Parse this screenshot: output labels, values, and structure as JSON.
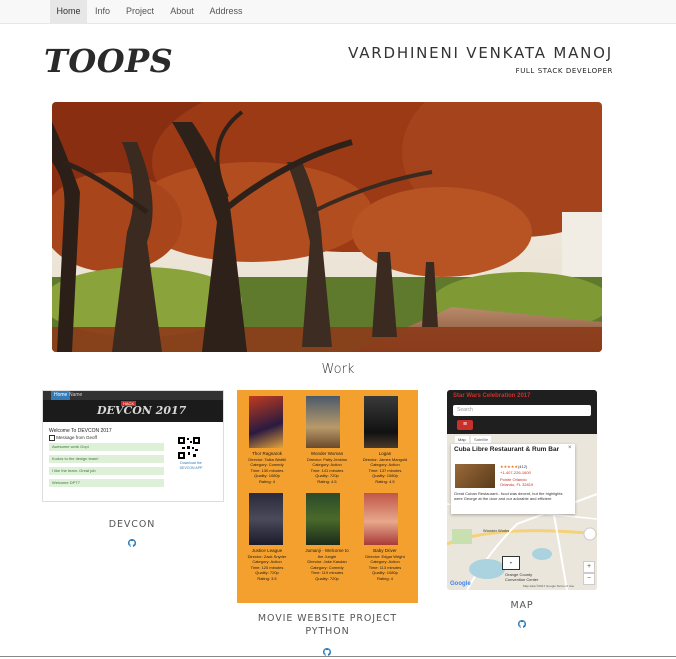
{
  "nav": {
    "items": [
      {
        "label": "Home",
        "active": true
      },
      {
        "label": "Info",
        "active": false
      },
      {
        "label": "Project",
        "active": false
      },
      {
        "label": "About",
        "active": false
      },
      {
        "label": "Address",
        "active": false
      }
    ]
  },
  "header": {
    "brand": "TOOPS",
    "name": "VARDHINENI VENKATA MANOJ",
    "role": "FULL STACK DEVELOPER"
  },
  "hero": {
    "image": "autumn tree-lined park path"
  },
  "work": {
    "title": "Work",
    "projects": [
      {
        "caption": "DEVCON",
        "link_icon": "github-icon",
        "preview": {
          "tabs": [
            "Home",
            "Name"
          ],
          "banner": "DEVCON 2017",
          "badge": "HACK",
          "welcome": "Welcome To DEVCON 2017",
          "checkbox_label": "Message from Geoff",
          "rows": [
            "Awesome work Gopi",
            "Kudos to the design team!",
            "I like the team. Great job",
            "Welcome DPT7"
          ],
          "qr_caption": "Download the DEVCON APP"
        }
      },
      {
        "caption": "MOVIE WEBSITE PROJECT PYTHON",
        "link_icon": "github-icon",
        "preview": {
          "accent": "#f4a02e",
          "movies": [
            {
              "title": "Thor Ragnarok",
              "director": "Director: Taika Waititi",
              "category": "Category: Comedy",
              "time": "Time: 130 minutes",
              "quality": "Quality: 1080p",
              "rating": "Rating: 4"
            },
            {
              "title": "Wonder Woman",
              "director": "Director: Patty Jenkins",
              "category": "Category: Action",
              "time": "Time: 141 minutes",
              "quality": "Quality: 720p",
              "rating": "Rating: 4.5"
            },
            {
              "title": "Logan",
              "director": "Director: James Mangold",
              "category": "Category: Action",
              "time": "Time: 137 minutes",
              "quality": "Quality: 1080p",
              "rating": "Rating: 4.5"
            },
            {
              "title": "Justice League",
              "director": "Director: Zack Snyder",
              "category": "Category: Action",
              "time": "Time: 120 minutes",
              "quality": "Quality: 720p",
              "rating": "Rating: 3.5"
            },
            {
              "title": "Jumanji - Welcome to",
              "director": "the Jungle",
              "category": "Director: Jake Kasdan",
              "time": "Category: Comedy",
              "quality": "Time: 119 minutes",
              "rating": "Quality: 720p"
            },
            {
              "title": "Baby Driver",
              "director": "Director: Edgar Wright",
              "category": "Category: Action",
              "time": "Time: 113 minutes",
              "quality": "Quality: 1080p",
              "rating": "Rating: 4"
            }
          ]
        }
      },
      {
        "caption": "MAP",
        "link_icon": "github-icon",
        "preview": {
          "title": "Star Wars Celebration 2017",
          "search_placeholder": "Search",
          "map_tabs": [
            "Map",
            "Satellite"
          ],
          "place_name": "Cuba Libre Restaurant & Rum Bar",
          "rating_count": "(412)",
          "phone": "+1-407-226-1600",
          "address_1": "Pointe Orlando",
          "address_2": "Orlando, FL 32819",
          "review": "Great Cuban Restaurant.. food was decent, but the highlights were George at the door and our adorable and efficient",
          "pois": [
            "Wonder Works",
            "Orange County Convention Center"
          ],
          "google": "Google",
          "footer": "Map data ©2017 Google  Terms of Use"
        }
      }
    ]
  }
}
